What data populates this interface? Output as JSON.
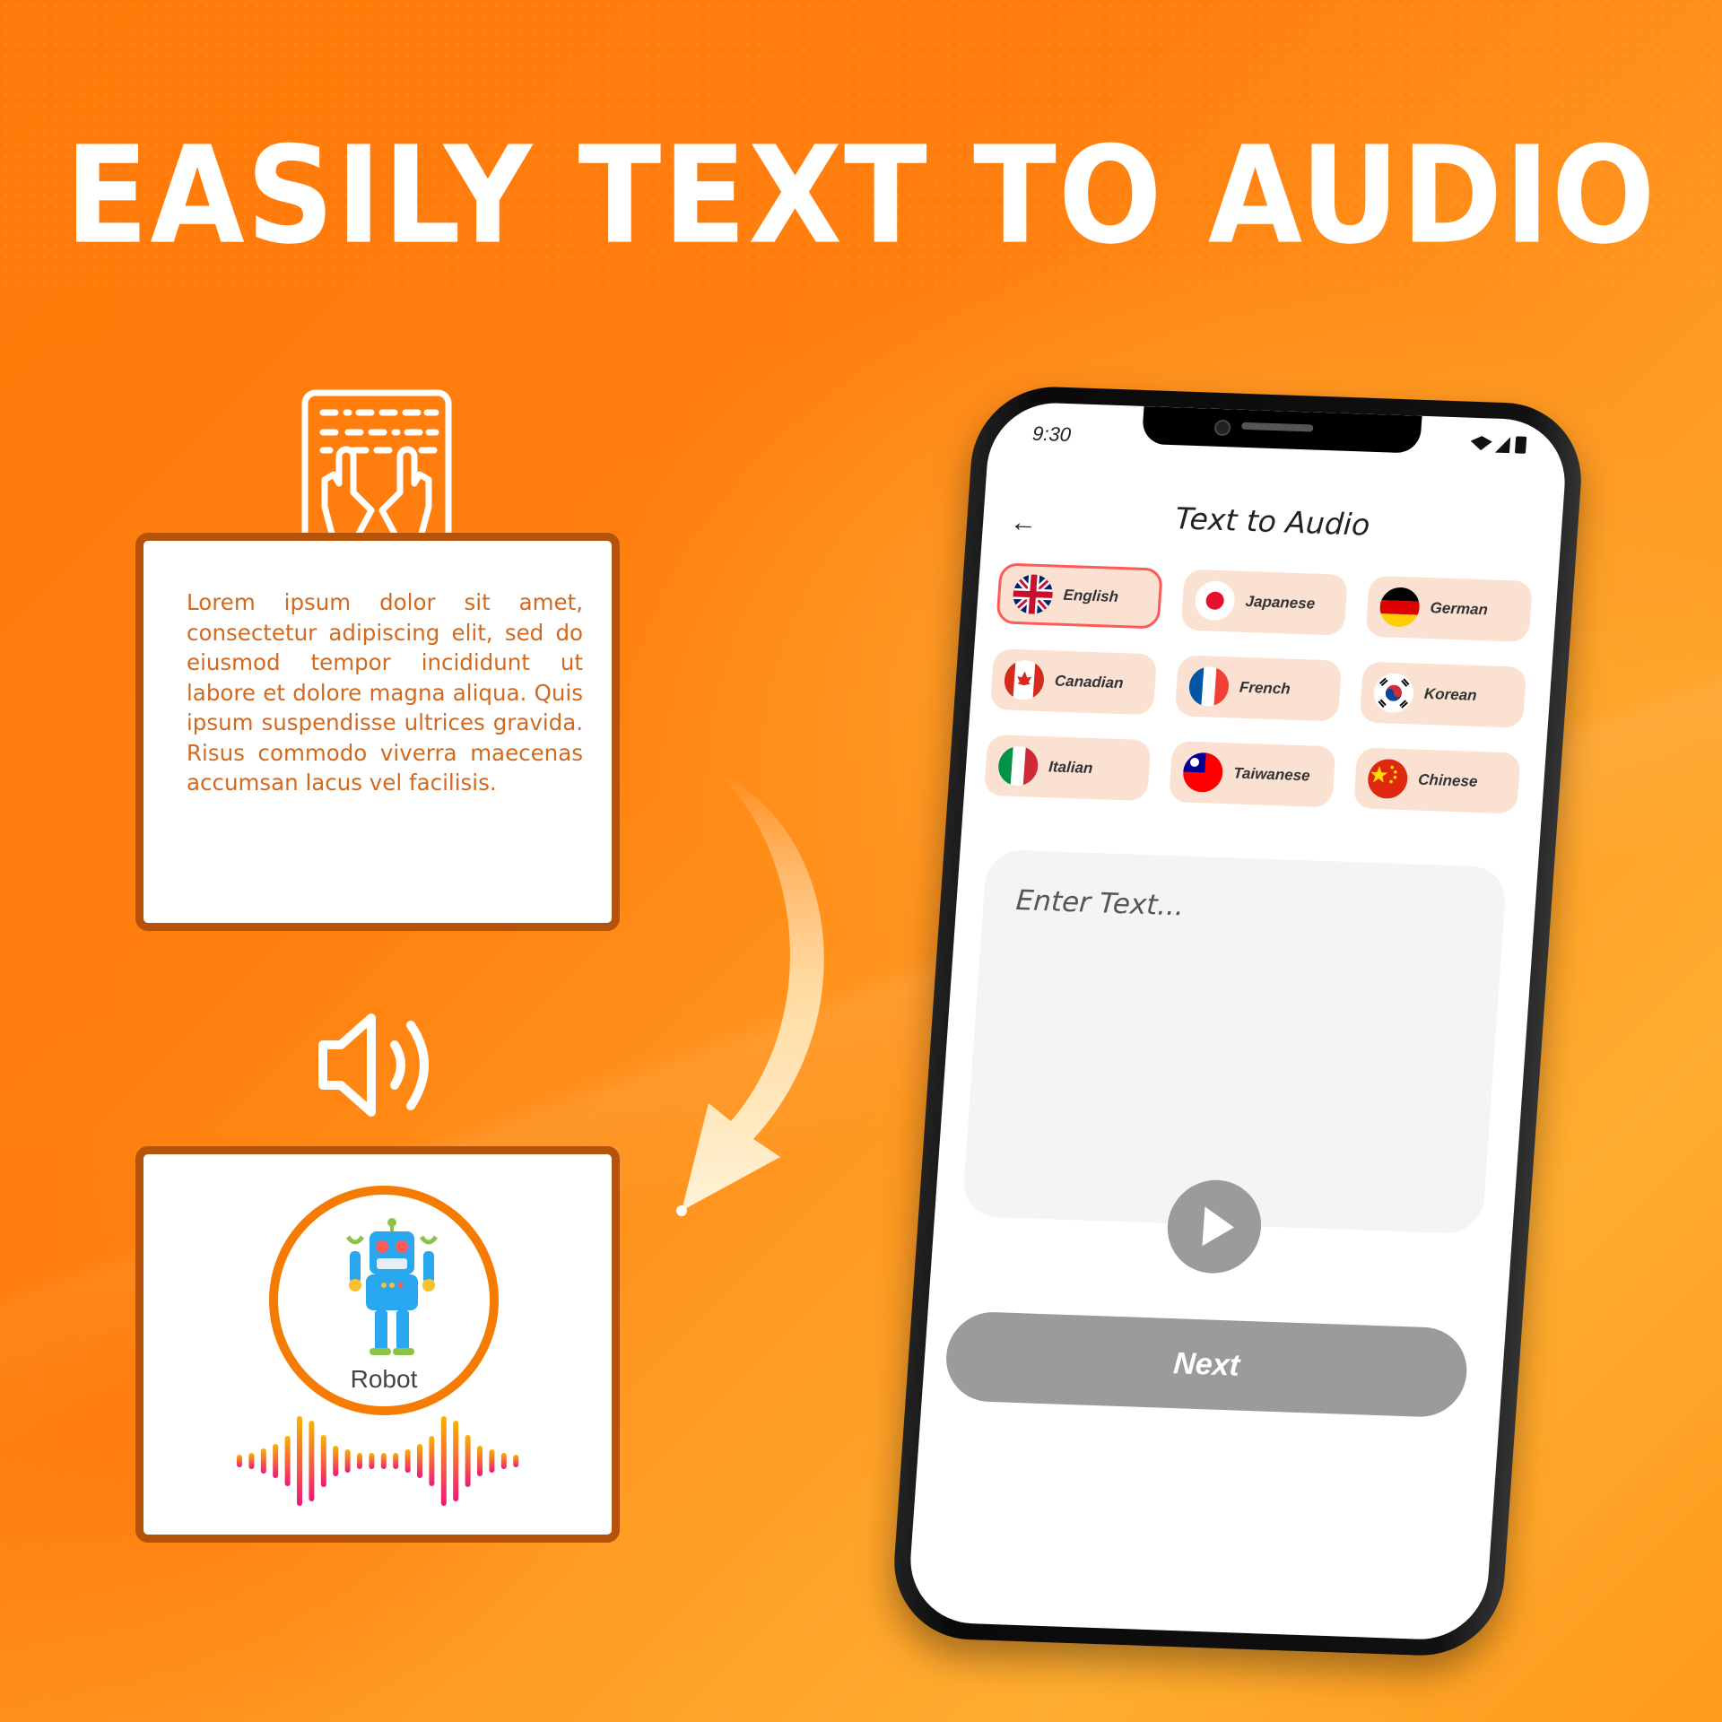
{
  "headline": "EASILY TEXT TO AUDIO",
  "text_card": {
    "body": "Lorem ipsum dolor sit amet, consectetur adipiscing elit, sed do eiusmod tempor incididunt ut labore et dolore magna aliqua. Quis ipsum suspendisse ultrices gravida. Risus commodo viverra maecenas accumsan lacus vel facilisis."
  },
  "audio_card": {
    "voice_label": "Robot"
  },
  "colors": {
    "accent": "#f57c00",
    "card_border": "#b45309",
    "chip_bg": "#fbe1d1",
    "selected_border": "#ff5a5a",
    "button_gray": "#9b9b9b"
  },
  "phone": {
    "status": {
      "time": "9:30"
    },
    "title": "Text to Audio",
    "languages": [
      {
        "label": "English",
        "flag": "uk",
        "selected": true
      },
      {
        "label": "Japanese",
        "flag": "jp",
        "selected": false
      },
      {
        "label": "German",
        "flag": "de",
        "selected": false
      },
      {
        "label": "Canadian",
        "flag": "ca",
        "selected": false
      },
      {
        "label": "French",
        "flag": "fr",
        "selected": false
      },
      {
        "label": "Korean",
        "flag": "kr",
        "selected": false
      },
      {
        "label": "Italian",
        "flag": "it",
        "selected": false
      },
      {
        "label": "Taiwanese",
        "flag": "tw",
        "selected": false
      },
      {
        "label": "Chinese",
        "flag": "cn",
        "selected": false
      }
    ],
    "input": {
      "placeholder": "Enter Text..."
    },
    "next_label": "Next"
  }
}
